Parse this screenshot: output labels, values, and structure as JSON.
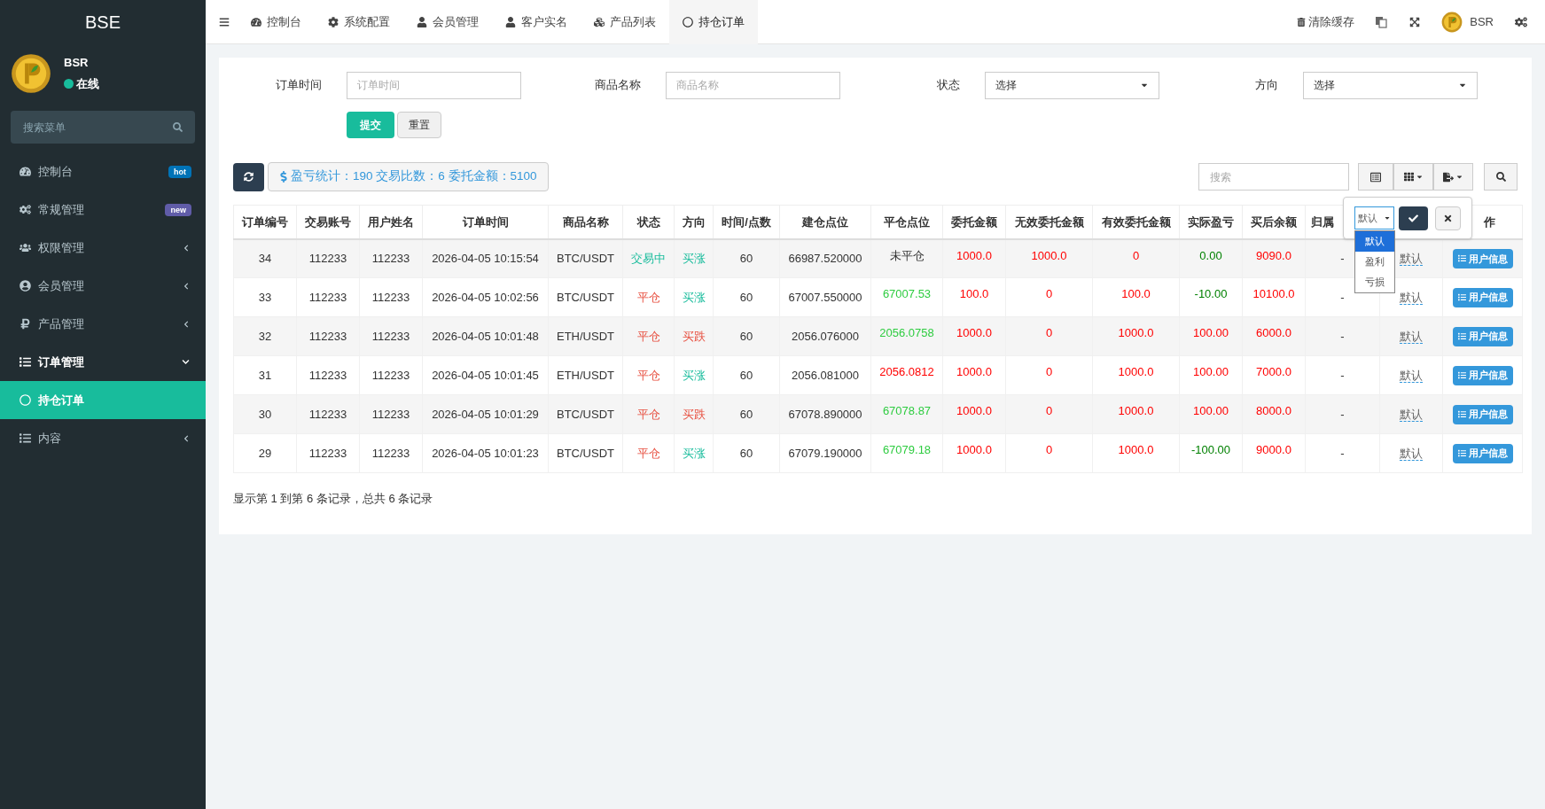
{
  "sidebar": {
    "brand": "BSE",
    "user": {
      "name": "BSR",
      "status": "在线",
      "online": true
    },
    "search": {
      "placeholder": "搜索菜单"
    },
    "items": [
      {
        "label": "控制台",
        "selected": false,
        "badge": {
          "text": "hot",
          "color": "#0073b7"
        }
      },
      {
        "label": "常规管理",
        "selected": false,
        "badge": {
          "text": "new",
          "color": "#605ca8"
        }
      },
      {
        "label": "权限管理",
        "selected": false,
        "expanded": false
      },
      {
        "label": "会员管理",
        "selected": false,
        "expanded": false
      },
      {
        "label": "产品管理",
        "selected": false,
        "expanded": false
      },
      {
        "label": "订单管理",
        "selected": false,
        "expanded": true,
        "children": [
          {
            "label": "持仓订单",
            "selected": true
          }
        ]
      },
      {
        "label": "内容",
        "selected": false,
        "expanded": false
      }
    ]
  },
  "topbar": {
    "tabs": [
      {
        "label": "控制台",
        "selected": false
      },
      {
        "label": "系统配置",
        "selected": false
      },
      {
        "label": "会员管理",
        "selected": false
      },
      {
        "label": "客户实名",
        "selected": false
      },
      {
        "label": "产品列表",
        "selected": false
      },
      {
        "label": "持仓订单",
        "selected": true
      }
    ],
    "clear_cache": "清除缓存",
    "user": "BSR"
  },
  "filters": [
    {
      "kind": "text",
      "label": "订单时间",
      "placeholder": "订单时间"
    },
    {
      "kind": "text",
      "label": "商品名称",
      "placeholder": "商品名称"
    },
    {
      "kind": "select",
      "label": "状态",
      "value": "选择"
    },
    {
      "kind": "select",
      "label": "方向",
      "value": "选择"
    }
  ],
  "form_buttons": {
    "submit": "提交",
    "reset": "重置"
  },
  "toolbar": {
    "stats": "盈亏统计：190 交易比数：6 委托金额：5100",
    "search_placeholder": "搜索"
  },
  "table": {
    "columns": [
      {
        "label": "订单编号"
      },
      {
        "label": "交易账号"
      },
      {
        "label": "用户姓名"
      },
      {
        "label": "订单时间"
      },
      {
        "label": "商品名称"
      },
      {
        "label": "状态"
      },
      {
        "label": "方向"
      },
      {
        "label": "时间/点数"
      },
      {
        "label": "建仓点位"
      },
      {
        "label": "平仓点位"
      },
      {
        "label": "委托金额"
      },
      {
        "label": "无效委托金额"
      },
      {
        "label": "有效委托金额"
      },
      {
        "label": "实际盈亏"
      },
      {
        "label": "买后余额"
      },
      {
        "label": "归属"
      },
      {},
      {
        "label": "作"
      }
    ],
    "rows": [
      {
        "id": "34",
        "account": "112233",
        "name": "112233",
        "time": "2026-04-05 10:15:54",
        "symbol": "BTC/USDT",
        "status": {
          "text": "交易中",
          "color": "#18bc9c"
        },
        "direction": {
          "text": "买涨",
          "color": "#18bc9c"
        },
        "points": "60",
        "open_price": "66987.520000",
        "close_price": {
          "text": "未平仓",
          "color": "#333333"
        },
        "amount": "1000.0",
        "invalid_amount": "1000.0",
        "valid_amount": "0",
        "profit": {
          "text": "0.00",
          "color": "#008000"
        },
        "balance": "9090.0",
        "owner": "-",
        "result": "默认",
        "action": "用户信息"
      },
      {
        "id": "33",
        "account": "112233",
        "name": "112233",
        "time": "2026-04-05 10:02:56",
        "symbol": "BTC/USDT",
        "status": {
          "text": "平仓",
          "color": "#e74c3c"
        },
        "direction": {
          "text": "买涨",
          "color": "#18bc9c"
        },
        "points": "60",
        "open_price": "67007.550000",
        "close_price": {
          "text": "67007.53",
          "color": "#2ecc40"
        },
        "amount": "100.0",
        "invalid_amount": "0",
        "valid_amount": "100.0",
        "profit": {
          "text": "-10.00",
          "color": "#008000"
        },
        "balance": "10100.0",
        "owner": "-",
        "result": "默认",
        "action": "用户信息"
      },
      {
        "id": "32",
        "account": "112233",
        "name": "112233",
        "time": "2026-04-05 10:01:48",
        "symbol": "ETH/USDT",
        "status": {
          "text": "平仓",
          "color": "#e74c3c"
        },
        "direction": {
          "text": "买跌",
          "color": "#e74c3c"
        },
        "points": "60",
        "open_price": "2056.076000",
        "close_price": {
          "text": "2056.0758",
          "color": "#2ecc40"
        },
        "amount": "1000.0",
        "invalid_amount": "0",
        "valid_amount": "1000.0",
        "profit": {
          "text": "100.00",
          "color": "#ff0000"
        },
        "balance": "6000.0",
        "owner": "-",
        "result": "默认",
        "action": "用户信息"
      },
      {
        "id": "31",
        "account": "112233",
        "name": "112233",
        "time": "2026-04-05 10:01:45",
        "symbol": "ETH/USDT",
        "status": {
          "text": "平仓",
          "color": "#e74c3c"
        },
        "direction": {
          "text": "买涨",
          "color": "#18bc9c"
        },
        "points": "60",
        "open_price": "2056.081000",
        "close_price": {
          "text": "2056.0812",
          "color": "#ff0000"
        },
        "amount": "1000.0",
        "invalid_amount": "0",
        "valid_amount": "1000.0",
        "profit": {
          "text": "100.00",
          "color": "#ff0000"
        },
        "balance": "7000.0",
        "owner": "-",
        "result": "默认",
        "action": "用户信息"
      },
      {
        "id": "30",
        "account": "112233",
        "name": "112233",
        "time": "2026-04-05 10:01:29",
        "symbol": "BTC/USDT",
        "status": {
          "text": "平仓",
          "color": "#e74c3c"
        },
        "direction": {
          "text": "买跌",
          "color": "#e74c3c"
        },
        "points": "60",
        "open_price": "67078.890000",
        "close_price": {
          "text": "67078.87",
          "color": "#2ecc40"
        },
        "amount": "1000.0",
        "invalid_amount": "0",
        "valid_amount": "1000.0",
        "profit": {
          "text": "100.00",
          "color": "#ff0000"
        },
        "balance": "8000.0",
        "owner": "-",
        "result": "默认",
        "action": "用户信息"
      },
      {
        "id": "29",
        "account": "112233",
        "name": "112233",
        "time": "2026-04-05 10:01:23",
        "symbol": "BTC/USDT",
        "status": {
          "text": "平仓",
          "color": "#e74c3c"
        },
        "direction": {
          "text": "买涨",
          "color": "#18bc9c"
        },
        "points": "60",
        "open_price": "67079.190000",
        "close_price": {
          "text": "67079.18",
          "color": "#2ecc40"
        },
        "amount": "1000.0",
        "invalid_amount": "0",
        "valid_amount": "1000.0",
        "profit": {
          "text": "-100.00",
          "color": "#008000"
        },
        "balance": "9000.0",
        "owner": "-",
        "result": "默认",
        "action": "用户信息"
      }
    ]
  },
  "editor": {
    "value": "默认",
    "options": [
      {
        "label": "默认",
        "selected": true
      },
      {
        "label": "盈利",
        "selected": false
      },
      {
        "label": "亏损",
        "selected": false
      }
    ]
  },
  "footer": "显示第 1 到第 6 条记录，总共 6 条记录"
}
